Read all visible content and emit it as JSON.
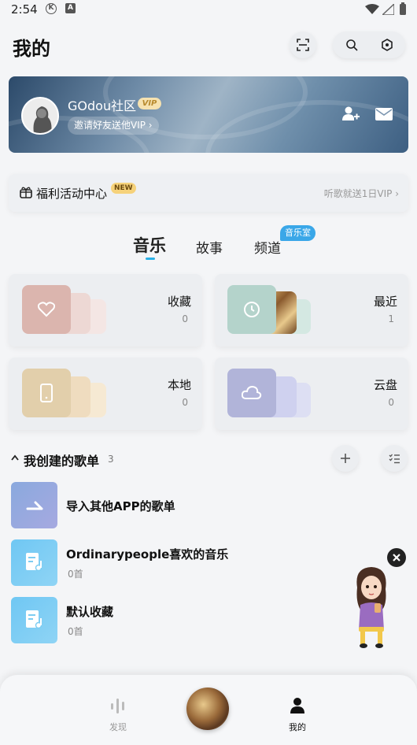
{
  "status_bar": {
    "time": "2:54",
    "icon_k": "K",
    "icon_a": "A"
  },
  "header": {
    "title": "我的"
  },
  "profile": {
    "username": "GOdou社区",
    "vip_badge": "VIP",
    "invite_text": "邀请好友送他VIP ›"
  },
  "welfare": {
    "label": "福利活动中心",
    "new_badge": "NEW",
    "hint": "听歌就送1日VIP ›"
  },
  "tabs": [
    {
      "label": "音乐"
    },
    {
      "label": "故事"
    },
    {
      "label": "频道"
    }
  ],
  "tab_badge": "音乐室",
  "cards": [
    {
      "title": "收藏",
      "count": "0",
      "color": "#e3c2bd"
    },
    {
      "title": "最近",
      "count": "1",
      "color": "#bcd7cf"
    },
    {
      "title": "本地",
      "count": "0",
      "color": "#ead8b8"
    },
    {
      "title": "云盘",
      "count": "0",
      "color": "#c0c2e2"
    }
  ],
  "playlists_section": {
    "title": "我创建的歌单",
    "count": "3"
  },
  "playlists": [
    {
      "title": "导入其他APP的歌单",
      "subtitle": "",
      "color": "#9eaee0"
    },
    {
      "title": "Ordinarypeople喜欢的音乐",
      "subtitle": "0首",
      "color": "#7dcdf2"
    },
    {
      "title": "默认收藏",
      "subtitle": "0首",
      "color": "#7dcdf2"
    }
  ],
  "bottom_nav": [
    {
      "label": "发现"
    },
    {
      "label": "我的"
    }
  ],
  "colors": {
    "accent": "#2ab0e6"
  }
}
